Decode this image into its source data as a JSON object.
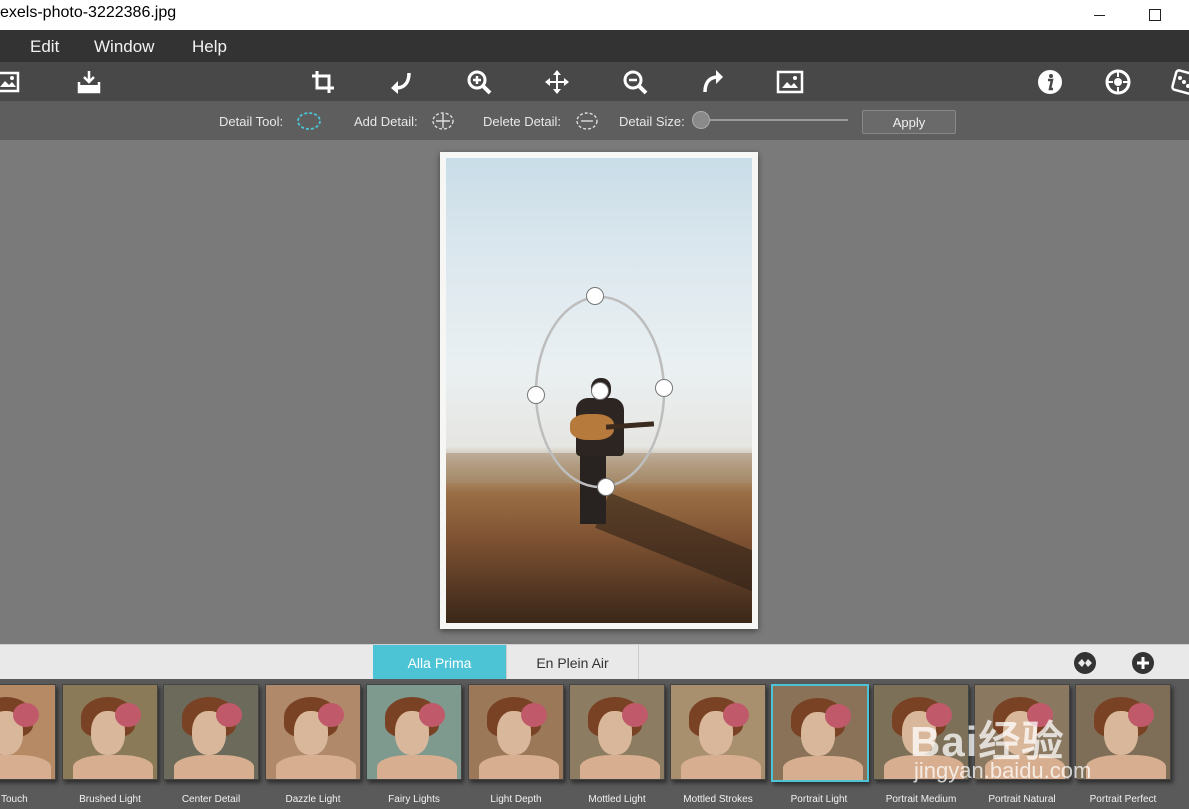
{
  "window": {
    "title": "exels-photo-3222386.jpg",
    "minimize": "—",
    "maximize": "□"
  },
  "menu": {
    "items": [
      "Edit",
      "Window",
      "Help"
    ]
  },
  "toolbar": {
    "icons": [
      "open-image-icon",
      "save-icon",
      "crop-icon",
      "undo-icon",
      "zoom-in-icon",
      "move-icon",
      "zoom-out-icon",
      "redo-icon",
      "image-view-icon",
      "info-icon",
      "settings-icon",
      "extras-icon"
    ]
  },
  "detail": {
    "tool_label": "Detail Tool:",
    "add_label": "Add Detail:",
    "delete_label": "Delete Detail:",
    "size_label": "Detail Size:",
    "apply_label": "Apply",
    "accent": "#4cc4d6",
    "size_value": 0
  },
  "tabs": {
    "items": [
      "Alla Prima",
      "En Plein Air"
    ],
    "active": "Alla Prima",
    "active_color": "#4cc4d6"
  },
  "presets": {
    "items": [
      "tic Touch",
      "Brushed Light",
      "Center Detail",
      "Dazzle Light",
      "Fairy Lights",
      "Light Depth",
      "Mottled Light",
      "Mottled Strokes",
      "Portrait Light",
      "Portrait Medium",
      "Portrait Natural",
      "Portrait Perfect"
    ],
    "selected": "Portrait Light"
  },
  "watermark": {
    "main": "Bai经验",
    "sub": "jingyan.baidu.com"
  }
}
